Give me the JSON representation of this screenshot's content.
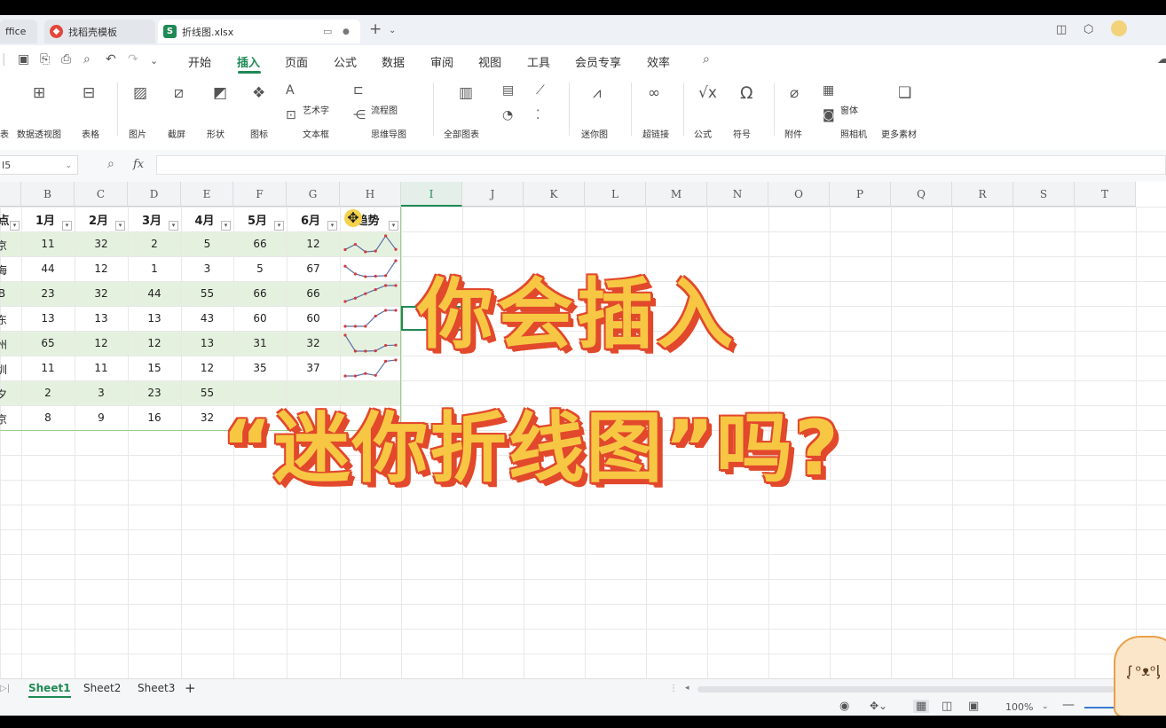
{
  "tabs": [
    {
      "label": "ffice"
    },
    {
      "label": "找稻壳模板"
    },
    {
      "label": "折线图.xlsx",
      "icon_letter": "S"
    }
  ],
  "menu": {
    "items": [
      "开始",
      "插入",
      "页面",
      "公式",
      "数据",
      "审阅",
      "视图",
      "工具",
      "会员专享",
      "效率"
    ],
    "active": "插入"
  },
  "ribbon": {
    "items": [
      "表",
      "数据透视图",
      "表格",
      "图片",
      "截屏",
      "形状",
      "图标",
      "艺术字",
      "文本框",
      "流程图",
      "思维导图",
      "全部图表",
      "迷你图",
      "超链接",
      "公式",
      "符号",
      "附件",
      "窗体",
      "照相机",
      "更多素材"
    ]
  },
  "formula_bar": {
    "name_box": "I5",
    "fx": "fx"
  },
  "columns": [
    "B",
    "C",
    "D",
    "E",
    "F",
    "G",
    "H",
    "I",
    "J",
    "K",
    "L",
    "M",
    "N",
    "O",
    "P",
    "Q",
    "R",
    "S",
    "T"
  ],
  "selected_column": "I",
  "table": {
    "headers": [
      "1月",
      "2月",
      "3月",
      "4月",
      "5月",
      "6月",
      "趋势"
    ],
    "rows": [
      {
        "label": "京",
        "values": [
          "11",
          "32",
          "2",
          "5",
          "66",
          "12"
        ],
        "spark": [
          11,
          32,
          2,
          5,
          66,
          12
        ]
      },
      {
        "label": "海",
        "values": [
          "44",
          "12",
          "1",
          "3",
          "5",
          "67"
        ],
        "spark": [
          44,
          12,
          1,
          3,
          5,
          67
        ]
      },
      {
        "label": "B",
        "values": [
          "23",
          "32",
          "44",
          "55",
          "66",
          "66"
        ],
        "spark": [
          23,
          32,
          44,
          55,
          66,
          66
        ]
      },
      {
        "label": "东",
        "values": [
          "13",
          "13",
          "13",
          "43",
          "60",
          "60"
        ],
        "spark": [
          13,
          13,
          13,
          43,
          60,
          60
        ]
      },
      {
        "label": "州",
        "values": [
          "65",
          "12",
          "12",
          "13",
          "31",
          "32"
        ],
        "spark": [
          65,
          12,
          12,
          13,
          31,
          32
        ]
      },
      {
        "label": "圳",
        "values": [
          "11",
          "11",
          "15",
          "12",
          "35",
          "37"
        ],
        "spark": [
          11,
          11,
          15,
          12,
          35,
          37
        ]
      },
      {
        "label": "夕",
        "values": [
          "2",
          "3",
          "23",
          "55",
          "",
          ""
        ],
        "spark": []
      },
      {
        "label": "京",
        "values": [
          "8",
          "9",
          "16",
          "32",
          "",
          ""
        ],
        "spark": []
      }
    ]
  },
  "overlay": {
    "line1": "你会插入",
    "line2": "“迷你折线图”吗?"
  },
  "sheets": [
    "Sheet1",
    "Sheet2",
    "Sheet3"
  ],
  "active_sheet": "Sheet1",
  "status": {
    "zoom": "100%"
  }
}
